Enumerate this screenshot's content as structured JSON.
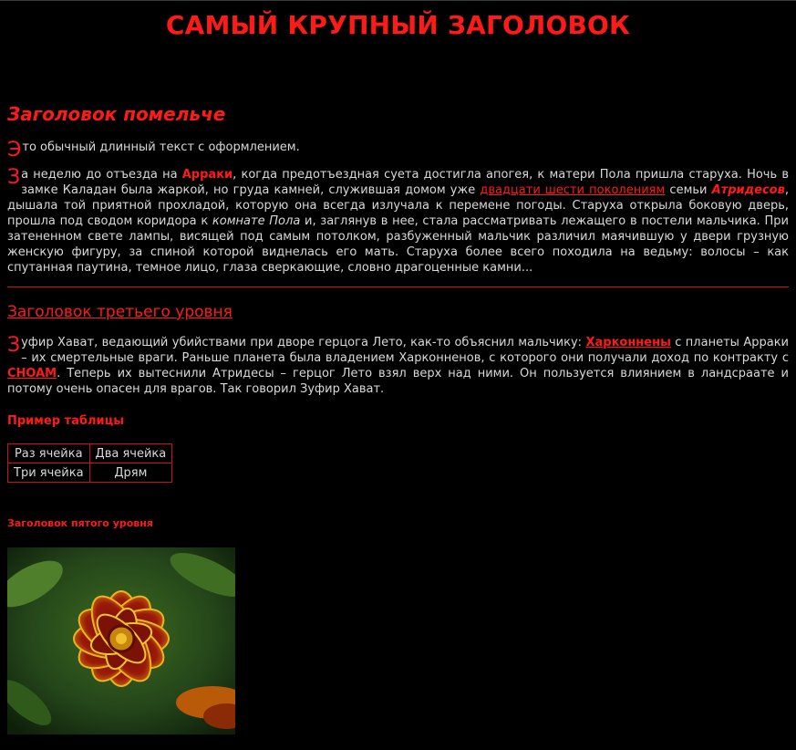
{
  "heading1": "САМЫЙ КРУПНЫЙ ЗАГОЛОВОК",
  "heading2": "Заголовок помельче",
  "intro": {
    "drop": "Э",
    "text": "то обычный длинный текст с оформлением."
  },
  "para1": {
    "drop": "З",
    "t1": "а неделю до отъезда на ",
    "arrakis": "Арраки",
    "t2": ", когда предотъездная суета достигла апогея, к матери Пола пришла старуха. Ночь в замке Каладан была жаркой, но груда камней, служившая домом уже ",
    "link": "двадцати шести поколениям",
    "t3": " семьи ",
    "atreides": "Атридесов",
    "t4": ", дышала той приятной прохладой, которую она всегда излучала к перемене погоды. Старуха открыла боковую дверь, прошла под сводом коридора к ",
    "room": "комнате Пола",
    "t5": " и, заглянув в нее, стала рассматривать лежащего в постели мальчика. При затененном свете лампы, висящей под самым потолком, разбуженный мальчик различил маячившую у двери грузную женскую фигуру, за спиной которой виднелась его мать. Старуха более всего походила на ведьму: волосы – как спутанная паутина, темное лицо, глаза сверкающие, словно драгоценные камни..."
  },
  "heading3": "Заголовок третьего уровня",
  "para2": {
    "drop": "З",
    "t1": "уфир Хават, ведающий убийствами при дворе герцога Лето, как-то объяснил мальчику: ",
    "harkonnen": "Харконнены",
    "t2": " с планеты Арраки – их смертельные враги. Раньше планета была владением Харконненов, с которого они получали доход по контракту с ",
    "choam": "CHOAM",
    "t3": ". Теперь их вытеснили Атридесы – герцог Лето взял верх над ними. Он пользуется влиянием в ландсраате и потому очень опасен для врагов. Так говорил Зуфир Хават."
  },
  "heading4": "Пример таблицы",
  "table": {
    "rows": [
      [
        "Раз ячейка",
        "Два ячейка"
      ],
      [
        "Три ячейка",
        "Дрям"
      ]
    ]
  },
  "heading5": "Заголовок пятого уровня",
  "colors": {
    "background": "#000000",
    "accent": "#ff1a1a",
    "text": "#d9d9d9"
  }
}
